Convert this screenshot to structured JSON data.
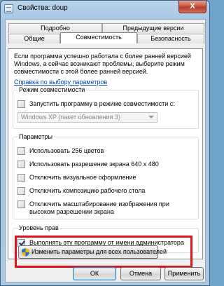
{
  "window": {
    "title": "Свойства: doup",
    "close_glyph": "X"
  },
  "tabs": {
    "row1": [
      {
        "label": "Подробно"
      },
      {
        "label": "Предыдущие версии"
      }
    ],
    "row2": [
      {
        "label": "Общие"
      },
      {
        "label": "Совместимость"
      },
      {
        "label": "Безопасность"
      }
    ]
  },
  "compat": {
    "intro": "Если программа успешно работала с более ранней версией Windows, а сейчас возникают проблемы, выберите режим совместимости с этой более ранней версией.",
    "help_link": "Справка по выбору параметров",
    "mode_group": {
      "title": "Режим совместимости",
      "checkbox": {
        "label": "Запустить программу в режиме совместимости с:",
        "checked": false
      },
      "select_value": "Windows XP (пакет обновления 3)"
    },
    "params_group": {
      "title": "Параметры",
      "items": [
        {
          "label": "Использовать 256 цветов",
          "checked": false
        },
        {
          "label": "Использовать разрешение экрана 640 x 480",
          "checked": false
        },
        {
          "label": "Отключить визуальное оформление",
          "checked": false
        },
        {
          "label": "Отключить композицию рабочего стола",
          "checked": false
        },
        {
          "label": "Отключить масштабирование изображения при высоком разрешении экрана",
          "checked": false
        }
      ]
    },
    "privilege_group": {
      "title": "Уровень прав",
      "checkbox": {
        "label": "Выполнять эту программу от имени администратора",
        "checked": true
      }
    },
    "all_users_button": "Изменить параметры для всех пользователей"
  },
  "buttons": {
    "ok": "ОК",
    "cancel": "Отмена",
    "apply": "Применить"
  },
  "colors": {
    "highlight": "#e0121b",
    "link": "#0645ad"
  }
}
